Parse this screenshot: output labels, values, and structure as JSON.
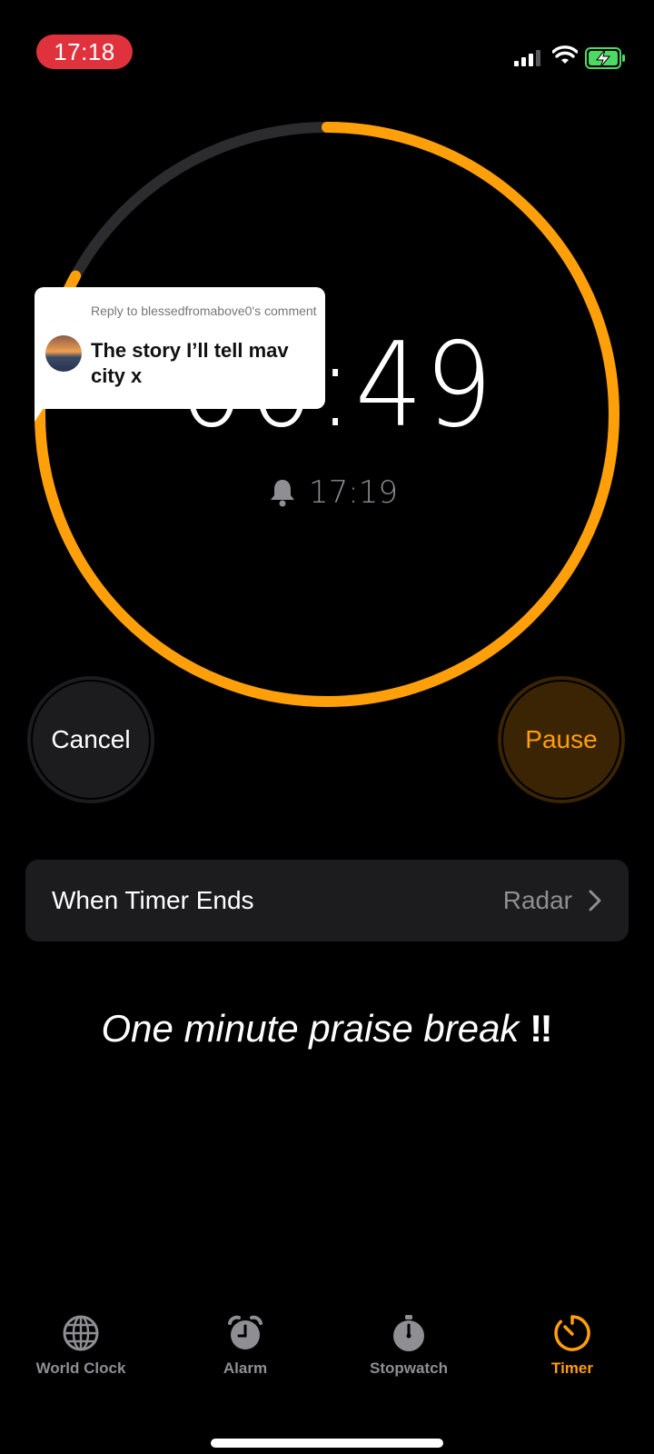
{
  "status_bar": {
    "time": "17:18"
  },
  "timer": {
    "countdown": "00:49",
    "alarm_time": "17:19",
    "progress_fraction": 0.83,
    "accent_color": "#ff9f0a",
    "track_color": "#2c2c2e"
  },
  "reply_overlay": {
    "meta": "Reply to blessedfromabove0's comment",
    "text": "The story I’ll tell mav city x"
  },
  "buttons": {
    "cancel_label": "Cancel",
    "pause_label": "Pause"
  },
  "when_timer_ends": {
    "label": "When Timer Ends",
    "value": "Radar"
  },
  "caption": {
    "text": "One minute praise break",
    "emoji": "‼"
  },
  "tabs": [
    {
      "label": "World Clock",
      "icon": "globe-icon"
    },
    {
      "label": "Alarm",
      "icon": "alarm-clock-icon"
    },
    {
      "label": "Stopwatch",
      "icon": "stopwatch-icon"
    },
    {
      "label": "Timer",
      "icon": "timer-icon",
      "active": true
    }
  ]
}
